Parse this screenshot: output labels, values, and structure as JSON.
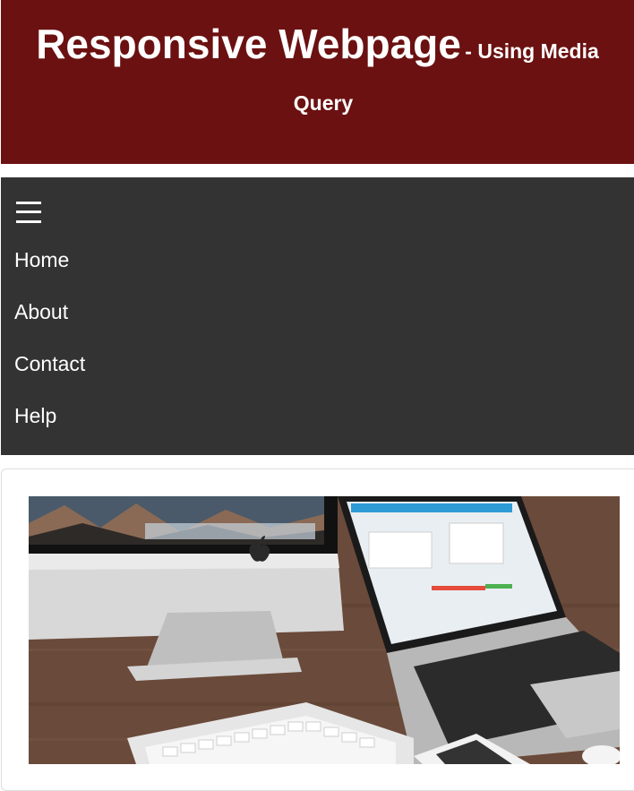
{
  "header": {
    "title": "Responsive Webpage",
    "subtitle_part1": "- Using Media",
    "subtitle_part2": "Query",
    "background_color": "#6b1111"
  },
  "nav": {
    "menu_icon": "hamburger-menu-icon",
    "background_color": "#333333",
    "items": [
      {
        "label": "Home"
      },
      {
        "label": "About"
      },
      {
        "label": "Contact"
      },
      {
        "label": "Help"
      }
    ]
  },
  "content": {
    "image": "desk-computers-photo"
  }
}
